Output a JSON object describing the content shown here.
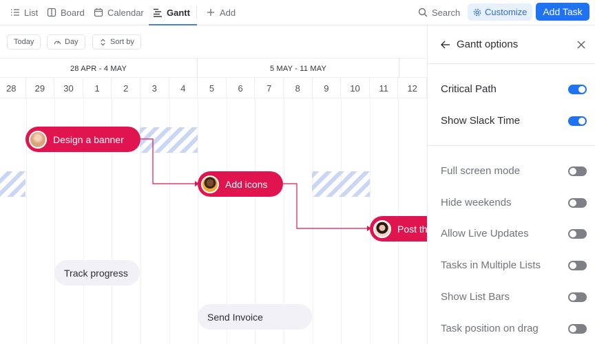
{
  "views": {
    "list": "List",
    "board": "Board",
    "calendar": "Calendar",
    "gantt": "Gantt",
    "add": "Add",
    "active": "Gantt"
  },
  "header": {
    "search": "Search",
    "customize": "Customize",
    "add_task": "Add Task"
  },
  "toolbar": {
    "today": "Today",
    "day": "Day",
    "sort": "Sort by"
  },
  "timeline": {
    "ranges": [
      "28 APR - 4 MAY",
      "5 MAY - 11 MAY"
    ],
    "days": [
      "28",
      "29",
      "30",
      "1",
      "2",
      "3",
      "4",
      "5",
      "6",
      "7",
      "8",
      "9",
      "10",
      "11",
      "12"
    ]
  },
  "tasks": {
    "design": "Design a banner",
    "icons": "Add icons",
    "post": "Post th",
    "track": "Track progress",
    "invoice": "Send Invoice"
  },
  "colors": {
    "task_bar": "#e0154f",
    "accent": "#1f73f2",
    "slack": "#c9d7f4"
  },
  "panel": {
    "title": "Gantt options",
    "options": [
      {
        "label": "Critical Path",
        "enabled": true
      },
      {
        "label": "Show Slack Time",
        "enabled": true
      },
      {
        "label": "Full screen mode",
        "enabled": false
      },
      {
        "label": "Hide weekends",
        "enabled": false
      },
      {
        "label": "Allow Live Updates",
        "enabled": false
      },
      {
        "label": "Tasks in Multiple Lists",
        "enabled": false
      },
      {
        "label": "Show List Bars",
        "enabled": false
      },
      {
        "label": "Task position on drag",
        "enabled": false
      }
    ]
  }
}
